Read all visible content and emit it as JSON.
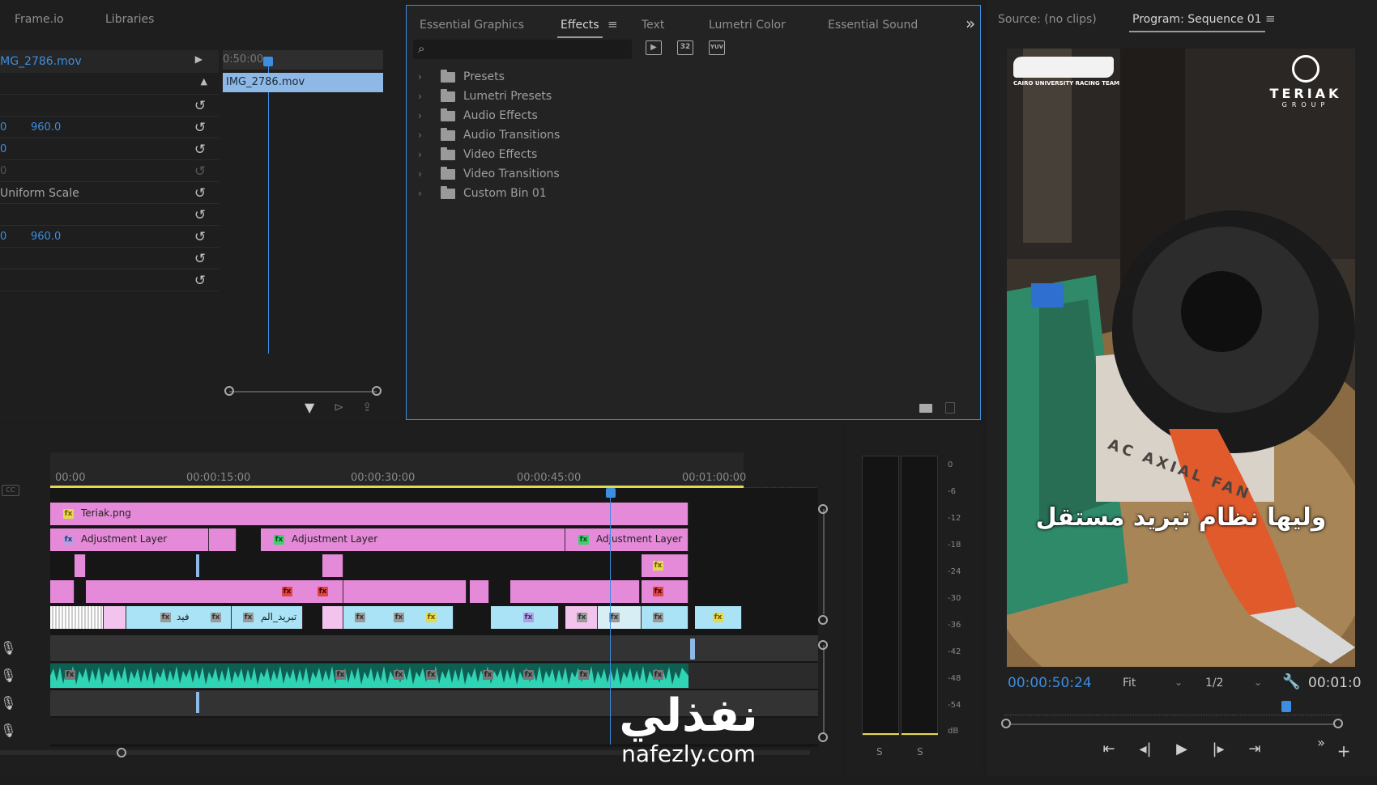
{
  "top_left_tabs": [
    "Frame.io",
    "Libraries"
  ],
  "effect_controls": {
    "clip_name": "IMG_2786.mov",
    "timecode": "0:50:00",
    "mini_clip": "IMG_2786.mov",
    "rows": [
      {
        "left": "",
        "value": ""
      },
      {
        "left": "0",
        "value": "960.0"
      },
      {
        "left": "0",
        "value": ""
      },
      {
        "left": "0",
        "value": ""
      },
      {
        "left": "Uniform Scale",
        "value": ""
      },
      {
        "left": "",
        "value": ""
      },
      {
        "left": "0",
        "value": "960.0"
      },
      {
        "left": "",
        "value": ""
      },
      {
        "left": "",
        "value": ""
      }
    ]
  },
  "effects_panel": {
    "tabs": [
      "Essential Graphics",
      "Effects",
      "Text",
      "Lumetri Color",
      "Essential Sound"
    ],
    "active_tab": "Effects",
    "overflow": "»",
    "search_placeholder": "",
    "filter_icons": [
      "32",
      "YUV"
    ],
    "items": [
      "Presets",
      "Lumetri Presets",
      "Audio Effects",
      "Audio Transitions",
      "Video Effects",
      "Video Transitions",
      "Custom Bin 01"
    ]
  },
  "monitor": {
    "source_tab": "Source: (no clips)",
    "program_tab": "Program: Sequence 01",
    "current_time": "00:00:50:24",
    "fit": "Fit",
    "resolution": "1/2",
    "duration": "00:01:0",
    "logo_left": "CAIRO UNIVERSITY RACING TEAM",
    "logo_right": "TERIAK",
    "logo_right_sub": "GROUP",
    "subtitle": "وليها نظام تبريد مستقل",
    "box_text": "AC AXIAL FAN",
    "playhead_fraction": 0.83
  },
  "timeline": {
    "ruler": [
      "00:00",
      "00:00:15:00",
      "00:00:30:00",
      "00:00:45:00",
      "00:01:00:00"
    ],
    "v_labels": [
      "Teriak.png",
      "Adjustment Layer",
      "Adjustment Layer",
      "Adjustment Layer"
    ],
    "clip_labels": [
      "فيد",
      "تبريد_الم"
    ],
    "track_toggles": [
      "S",
      "S"
    ]
  },
  "audio_meter": {
    "scale": [
      "0",
      "-6",
      "-12",
      "-18",
      "-24",
      "-30",
      "-36",
      "-42",
      "-48",
      "-54",
      "dB"
    ]
  },
  "watermark": {
    "arabic": "نفذلي",
    "latin": "nafezly.com"
  },
  "colors": {
    "accent_blue": "#3d8de0",
    "clip_pink": "#e58ad8",
    "clip_cyan": "#a9e3f5",
    "audio_teal": "#2fd4b5"
  }
}
